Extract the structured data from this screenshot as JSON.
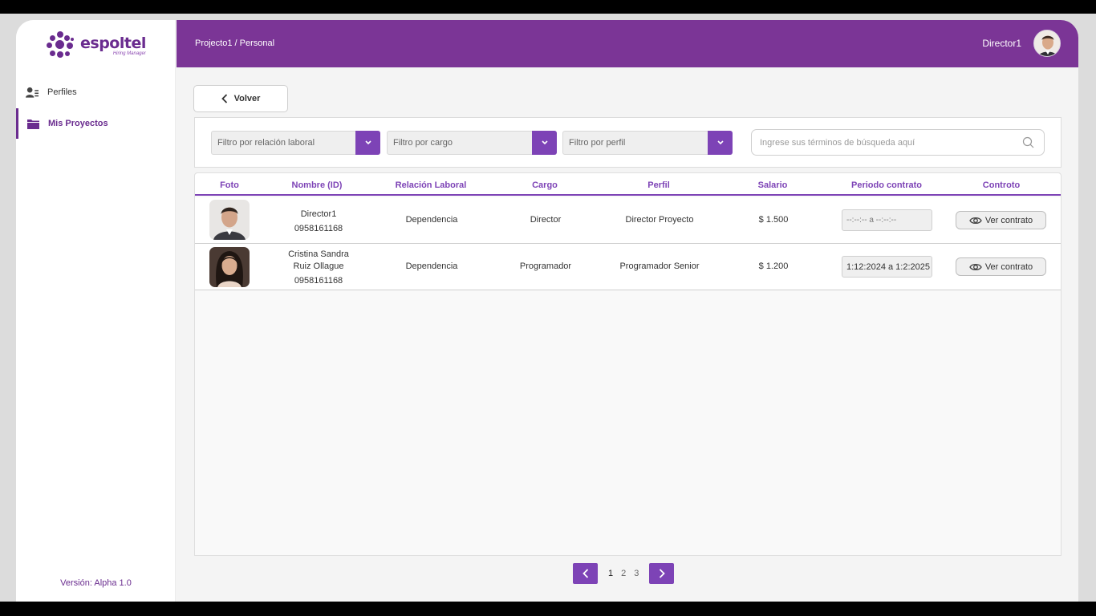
{
  "app": {
    "logo_text": "espoltel",
    "logo_subtitle": "Hiring Manager",
    "version": "Versión: Alpha 1.0"
  },
  "sidebar": {
    "items": [
      {
        "label": "Perfiles",
        "icon": "user-list-icon",
        "active": false
      },
      {
        "label": "Mis Proyectos",
        "icon": "folder-icon",
        "active": true
      }
    ]
  },
  "header": {
    "breadcrumb": "Projecto1 / Personal",
    "user_name": "Director1"
  },
  "toolbar": {
    "back_label": "Volver"
  },
  "filters": {
    "relacion": "Filtro por relación laboral",
    "cargo": "Filtro por cargo",
    "perfil": "Filtro por perfil",
    "search_placeholder": "Ingrese sus términos de búsqueda aquí"
  },
  "table": {
    "columns": [
      "Foto",
      "Nombre (ID)",
      "Relación Laboral",
      "Cargo",
      "Perfil",
      "Salario",
      "Periodo contrato",
      "Controto"
    ],
    "rows": [
      {
        "name_line1": "Director1",
        "name_line2": "",
        "id": "0958161168",
        "relacion": "Dependencia",
        "cargo": "Director",
        "perfil": "Director Proyecto",
        "salario": "$ 1.500",
        "periodo": "--:--:-- a --:--:--",
        "contrato_label": "Ver contrato"
      },
      {
        "name_line1": "Cristina Sandra",
        "name_line2": "Ruiz Ollague",
        "id": "0958161168",
        "relacion": "Dependencia",
        "cargo": "Programador",
        "perfil": "Programador Senior",
        "salario": "$ 1.200",
        "periodo": "1:12:2024 a 1:2:2025",
        "contrato_label": "Ver contrato"
      }
    ]
  },
  "pagination": {
    "pages": [
      "1",
      "2",
      "3"
    ],
    "current": "1"
  },
  "colors": {
    "primary": "#7b3596",
    "accent": "#7d43b6"
  }
}
